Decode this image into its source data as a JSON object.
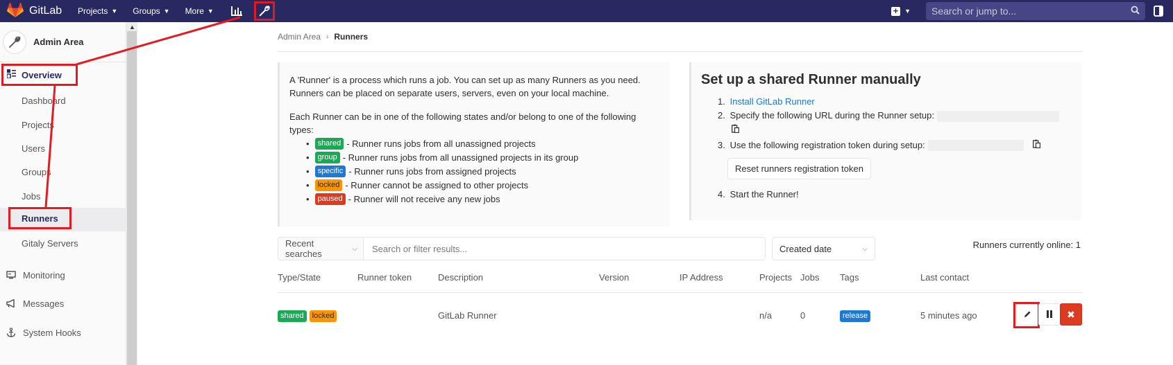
{
  "navbar": {
    "brand": "GitLab",
    "menu": [
      {
        "label": "Projects",
        "icon": "chevron-down-icon"
      },
      {
        "label": "Groups",
        "icon": "chevron-down-icon"
      },
      {
        "label": "More",
        "icon": "chevron-down-icon"
      }
    ],
    "search_placeholder": "Search or jump to..."
  },
  "sidebar": {
    "title": "Admin Area",
    "items": [
      {
        "label": "Overview",
        "icon": "overview-icon"
      },
      {
        "label": "Dashboard"
      },
      {
        "label": "Projects"
      },
      {
        "label": "Users"
      },
      {
        "label": "Groups"
      },
      {
        "label": "Jobs"
      },
      {
        "label": "Runners"
      },
      {
        "label": "Gitaly Servers"
      },
      {
        "label": "Monitoring",
        "icon": "monitor-icon"
      },
      {
        "label": "Messages",
        "icon": "megaphone-icon"
      },
      {
        "label": "System Hooks",
        "icon": "anchor-icon"
      }
    ]
  },
  "breadcrumb": {
    "root": "Admin Area",
    "current": "Runners"
  },
  "info": {
    "intro": "A 'Runner' is a process which runs a job. You can set up as many Runners as you need. Runners can be placed on separate users, servers, even on your local machine.",
    "states_intro": "Each Runner can be in one of the following states and/or belong to one of the following types:",
    "states": [
      {
        "badge": "shared",
        "color": "#1aaa55",
        "text": " - Runner runs jobs from all unassigned projects"
      },
      {
        "badge": "group",
        "color": "#1aaa55",
        "text": " - Runner runs jobs from all unassigned projects in its group"
      },
      {
        "badge": "specific",
        "color": "#1f78d1",
        "text": " - Runner runs jobs from assigned projects"
      },
      {
        "badge": "locked",
        "color": "#fc9403",
        "text": " - Runner cannot be assigned to other projects"
      },
      {
        "badge": "paused",
        "color": "#db3b21",
        "text": " - Runner will not receive any new jobs"
      }
    ]
  },
  "setup": {
    "title": "Set up a shared Runner manually",
    "step1_link": "Install GitLab Runner",
    "step2": "Specify the following URL during the Runner setup:",
    "step3": "Use the following registration token during setup:",
    "reset_button": "Reset runners registration token",
    "step4": "Start the Runner!"
  },
  "filter": {
    "recent_searches": "Recent searches",
    "placeholder": "Search or filter results...",
    "sort": "Created date",
    "online": "Runners currently online: 1"
  },
  "table": {
    "headers": [
      "Type/State",
      "Runner token",
      "Description",
      "Version",
      "IP Address",
      "Projects",
      "Jobs",
      "Tags",
      "Last contact"
    ],
    "rows": [
      {
        "badges": [
          "shared",
          "locked"
        ],
        "description": "GitLab Runner",
        "projects": "n/a",
        "jobs": "0",
        "tag": "release",
        "last_contact": "5 minutes ago"
      }
    ]
  },
  "colors": {
    "navbar": "#292961",
    "annotation_red": "#e21b23",
    "link": "#1f78d1"
  }
}
